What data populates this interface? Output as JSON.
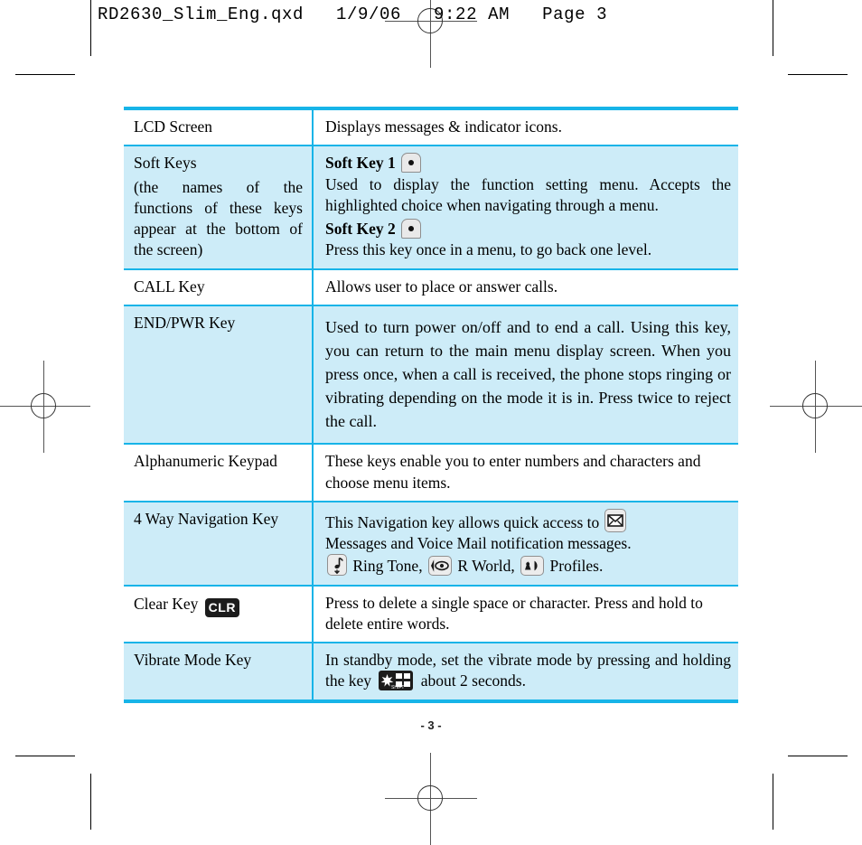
{
  "page_header": "RD2630_Slim_Eng.qxd   1/9/06   9:22 AM   Page 3",
  "page_number": "- 3 -",
  "colors": {
    "rule": "#17b4e8",
    "shading": "#cdecf8",
    "text": "#000000",
    "key_black": "#1c1c1c"
  },
  "table": {
    "rows": [
      {
        "label": "LCD Screen",
        "shaded": false,
        "description": "Displays messages & indicator icons."
      },
      {
        "label": "Soft Keys",
        "label_note": "(the names of the functions of these keys appear at the bottom of the screen)",
        "shaded": true,
        "softkey1_title": "Soft Key 1",
        "softkey1_desc": "Used to display the function setting menu. Accepts the highlighted choice when navigating through a menu.",
        "softkey2_title": "Soft Key 2",
        "softkey2_desc": "Press this key once in a menu, to go back one level."
      },
      {
        "label": "CALL Key",
        "shaded": false,
        "description": "Allows user to place or answer calls."
      },
      {
        "label": "END/PWR Key",
        "shaded": true,
        "description": "Used to turn power on/off and to end a call. Using this key, you can return to the main menu display screen. When you press once, when a call is received, the phone stops ringing or vibrating depending on the mode it is in. Press twice to reject the call."
      },
      {
        "label": "Alphanumeric Keypad",
        "shaded": false,
        "description": "These keys enable you to enter numbers and characters and choose menu items."
      },
      {
        "label": "4 Way Navigation Key",
        "shaded": true,
        "nav_line1_a": "This Navigation key allows quick access to",
        "nav_line2": "Messages and Voice Mail notification messages.",
        "nav_ringtone": "Ring Tone,",
        "nav_rworld": "R World,",
        "nav_profiles": "Profiles."
      },
      {
        "label": "Clear Key",
        "label_badge": "CLR",
        "shaded": false,
        "description": "Press to delete a single space or character. Press and hold to delete entire words."
      },
      {
        "label": "Vibrate Mode Key",
        "shaded": true,
        "vib_part1": "In standby mode, set the vibrate mode by pressing and holding the key",
        "vib_part2": "about 2 seconds."
      }
    ]
  },
  "icons": {
    "soft_key": "soft-key-icon",
    "envelope": "envelope-icon",
    "ring_tone": "music-note-icon",
    "r_world": "eye-icon",
    "profiles": "speaker-icon",
    "clear": "clr-key-icon",
    "vibrate": "star-shift-key-icon"
  }
}
